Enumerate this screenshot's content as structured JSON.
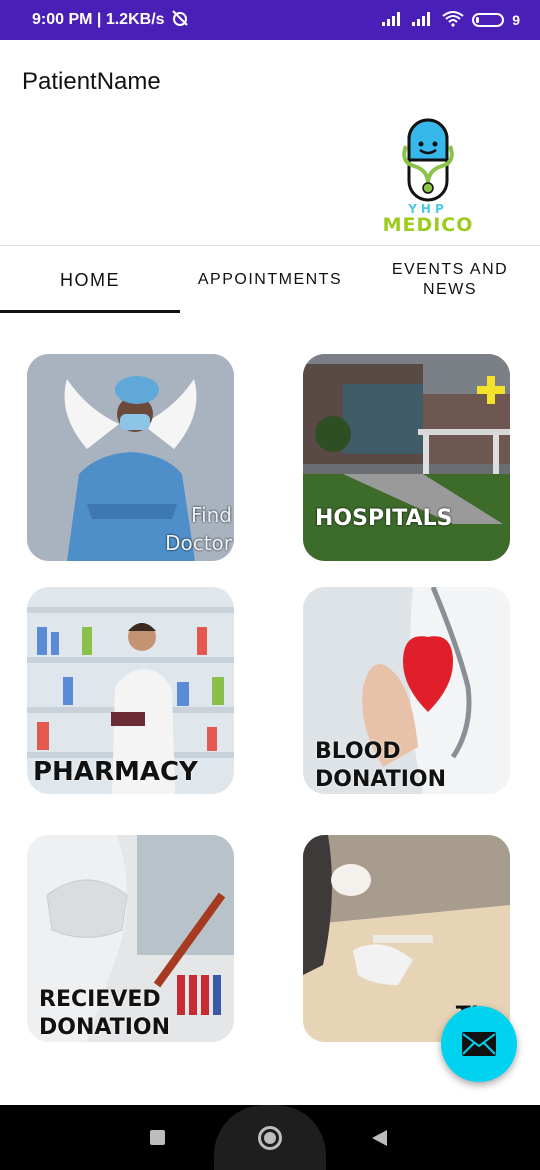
{
  "status_bar": {
    "time_speed": "9:00 PM | 1.2KB/s",
    "battery": "9",
    "background_color": "#4a1fb8"
  },
  "app_bar": {
    "patient_name": "PatientName",
    "logo_text": "MEDICO",
    "logo_sub": "YHP"
  },
  "tabs": [
    {
      "label": "HOME",
      "active": true
    },
    {
      "label": "APPOINTMENTS",
      "active": false
    },
    {
      "label": "EVENTS AND NEWS",
      "active": false
    }
  ],
  "cards": {
    "find_doctor": "Find Doctor",
    "hospitals": "HOSPITALS",
    "pharmacy": "PHARMACY",
    "blood_donation": "BLOOD DONATION",
    "recieved_donation": "RECIEVED DONATION",
    "tips_partial": "TI..."
  },
  "fab": {
    "icon": "mail-icon",
    "color": "#00d2ef"
  },
  "nav_bar": {
    "icons": [
      "recents-icon",
      "home-icon",
      "back-icon"
    ]
  }
}
